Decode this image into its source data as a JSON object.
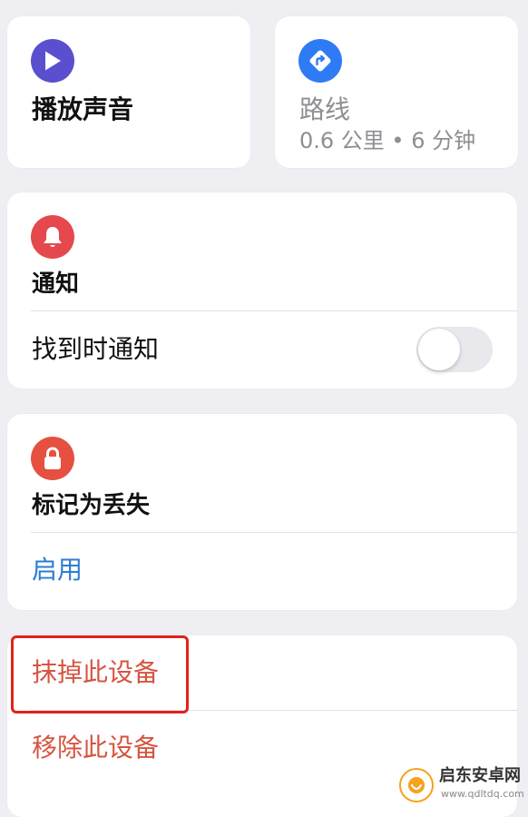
{
  "colors": {
    "background": "#efeff3",
    "card": "#ffffff",
    "play_icon": "#5a4fcf",
    "directions_icon": "#2f7bf5",
    "notify_icon": "#e5484d",
    "lost_icon": "#e55040",
    "link_blue": "#2d7dd2",
    "destructive_red": "#d65440",
    "secondary_gray": "#8e8e93",
    "highlight_border": "#e0231c"
  },
  "play_sound": {
    "icon": "play-icon",
    "label": "播放声音"
  },
  "directions": {
    "icon": "directions-icon",
    "label": "路线",
    "detail": "0.6 公里 • 6 分钟"
  },
  "notifications": {
    "icon": "bell-icon",
    "title": "通知",
    "row_label": "找到时通知",
    "toggle_on": false
  },
  "lost_mode": {
    "icon": "lock-icon",
    "title": "标记为丢失",
    "action_label": "启用"
  },
  "device_actions": {
    "erase_label": "抹掉此设备",
    "remove_label": "移除此设备"
  },
  "watermark": {
    "name": "启东安卓网",
    "url": "www.qdltdq.com"
  }
}
